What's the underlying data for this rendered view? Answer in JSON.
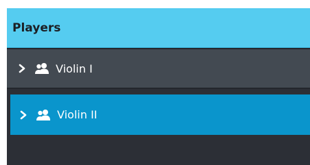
{
  "panel": {
    "title": "Players"
  },
  "players": [
    {
      "label": "Violin I",
      "selected": false,
      "icons": [
        "chevron-right-icon",
        "players-icon"
      ]
    },
    {
      "label": "Violin II",
      "selected": true,
      "icons": [
        "chevron-right-icon",
        "players-icon"
      ]
    }
  ],
  "colors": {
    "header_bg": "#55ccf0",
    "panel_bg": "#2c2f36",
    "row_bg": "#434a52",
    "selected_row_bg": "#0a95cc",
    "text": "#ffffff"
  }
}
